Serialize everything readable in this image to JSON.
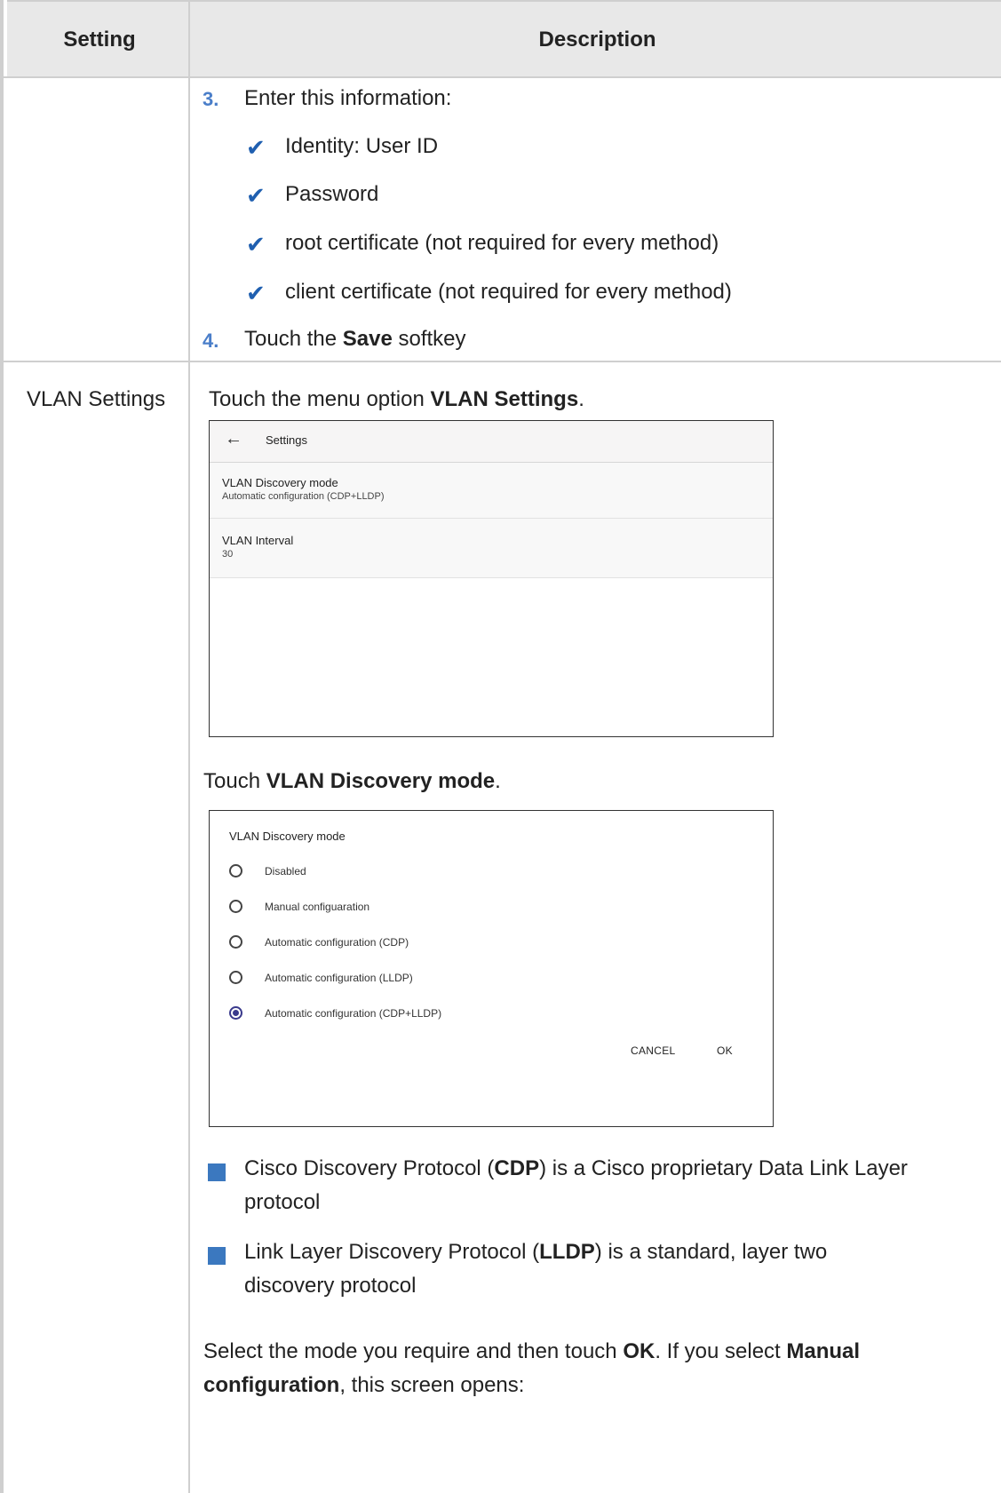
{
  "table": {
    "headers": [
      "Setting",
      "Description"
    ]
  },
  "row1": {
    "step3_num": "3.",
    "step3_text": "Enter this information:",
    "checks": [
      "Identity: User ID",
      "Password",
      "root certificate (not required for every method)",
      "client certificate (not required for every method)"
    ],
    "step4_num": "4.",
    "step4_pre": "Touch the ",
    "step4_bold": "Save",
    "step4_post": " softkey"
  },
  "row2": {
    "setting": "VLAN Settings",
    "intro_pre": "Touch the menu option ",
    "intro_bold": "VLAN Settings",
    "intro_post": ".",
    "touch2_pre": "Touch ",
    "touch2_bold": "VLAN Discovery mode",
    "touch2_post": ".",
    "bullet1": {
      "pre": "Cisco Discovery Protocol (",
      "bold": "CDP",
      "post_line1": ") is a Cisco proprietary Data Link Layer",
      "line2": "protocol"
    },
    "bullet2": {
      "pre": "Link Layer Discovery Protocol (",
      "bold": "LLDP",
      "post_line1": ") is a standard, layer two",
      "line2": "discovery protocol"
    },
    "final": {
      "l1_pre": "Select the mode you require and then touch ",
      "l1_bold1": "OK",
      "l1_mid": ". If you select ",
      "l1_bold2": "Manual",
      "l2_bold": "configuration",
      "l2_post": ", this screen opens:"
    }
  },
  "settings_screen": {
    "back_glyph": "←",
    "title": "Settings",
    "items": [
      {
        "title": "VLAN Discovery mode",
        "value": "Automatic configuration (CDP+LLDP)"
      },
      {
        "title": "VLAN Interval",
        "value": "30"
      }
    ]
  },
  "dialog": {
    "title": "VLAN Discovery mode",
    "options": [
      {
        "label": "Disabled",
        "selected": false
      },
      {
        "label": "Manual configuaration",
        "selected": false
      },
      {
        "label": "Automatic configuration (CDP)",
        "selected": false
      },
      {
        "label": "Automatic configuration (LLDP)",
        "selected": false
      },
      {
        "label": "Automatic configuration (CDP+LLDP)",
        "selected": true
      }
    ],
    "cancel": "CANCEL",
    "ok": "OK"
  },
  "colors": {
    "accent_blue": "#3b78bf",
    "check_blue": "#1f5fb0",
    "number_blue": "#4a7ec9",
    "header_bg": "#e8e8e8",
    "border": "#cfcfcf"
  }
}
